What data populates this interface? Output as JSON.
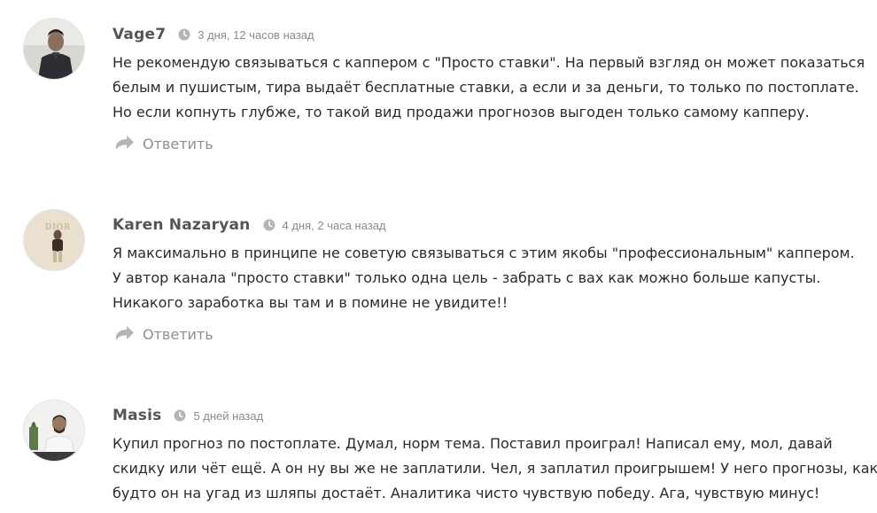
{
  "comments": [
    {
      "author": "Vage7",
      "date": "3 дня, 12 часов назад",
      "lines": [
        "Не рекомендую связываться с каппером с \"Просто ставки\". На первый взгляд он может показаться",
        "белым и пушистым, тира выдаёт бесплатные ставки, а если и за деньги, то только по постоплате.",
        "Но если копнуть глубже, то такой вид продажи прогнозов выгоден только самому капперу."
      ],
      "reply_label": "Ответить"
    },
    {
      "author": "Karen Nazaryan",
      "date": "4 дня, 2 часа назад",
      "avatar_text": "DIOR",
      "lines": [
        "Я максимально в принципе не советую связываться с этим якобы \"профессиональным\" каппером.",
        "У автор канала \"просто ставки\" только одна цель - забрать с вах как можно больше капусты.",
        "Никакого заработка вы там и в помине не увидите!!"
      ],
      "reply_label": "Ответить"
    },
    {
      "author": "Masis",
      "date": "5 дней назад",
      "lines": [
        "Купил прогноз по постоплате. Думал, норм тема. Поставил проиграл! Написал ему, мол, давай",
        "скидку или чёт ещё. А он ну вы же не заплатили. Чел, я заплатил проигрышем! У него прогнозы, как",
        "будто он на угад из шляпы достаёт. Аналитика чисто чувствую победу. Ага, чувствую минус!"
      ]
    }
  ],
  "colors": {
    "author": "#555555",
    "date": "#8a8a8a",
    "text": "#2b2b2b",
    "reply": "#8f8f8f",
    "icon": "#b5b5b5"
  },
  "icons": {
    "time": "clock-icon",
    "reply": "reply-arrow-icon"
  }
}
